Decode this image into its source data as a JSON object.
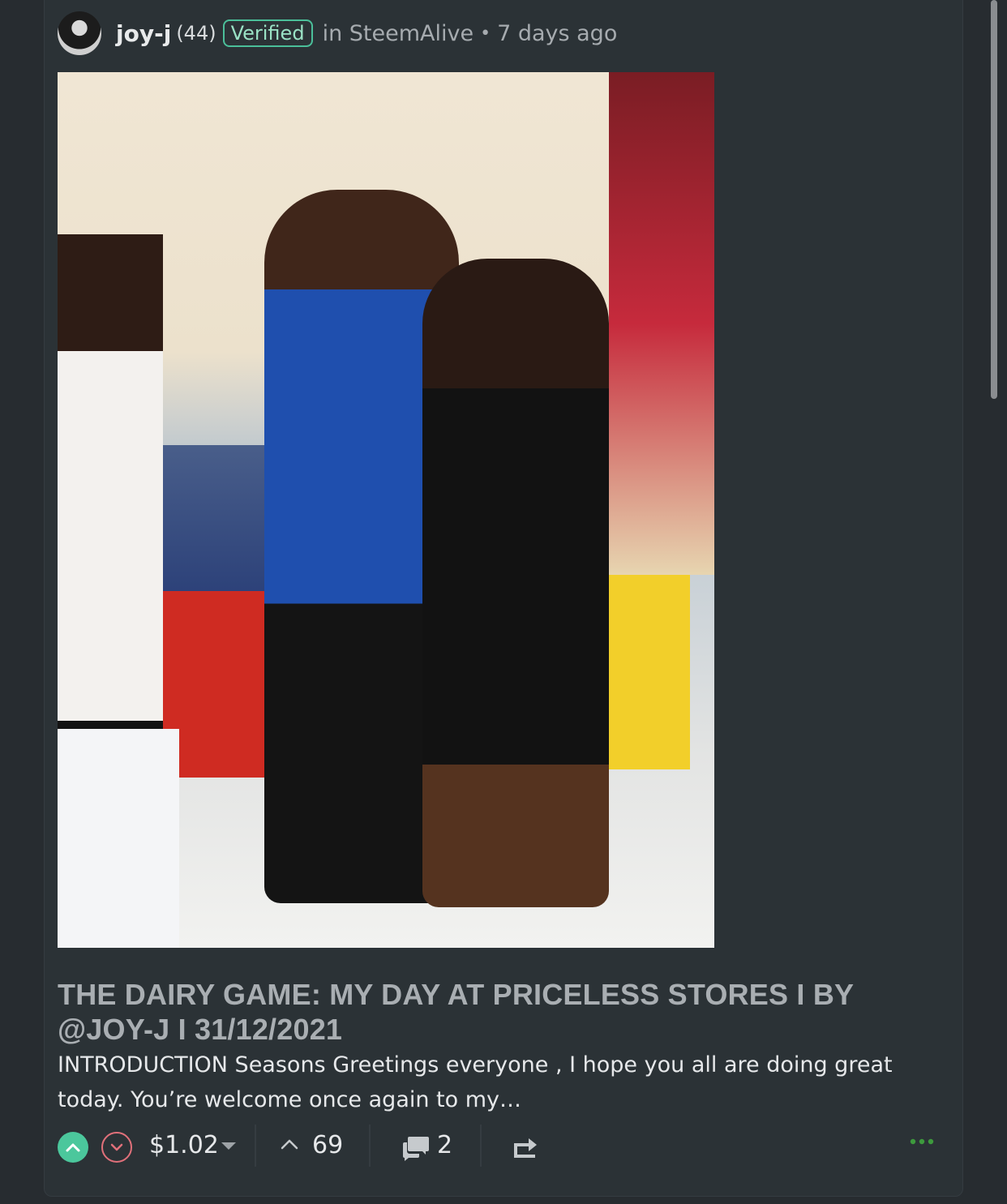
{
  "post": {
    "author": "joy-j",
    "reputation": "(44)",
    "badge": "Verified",
    "community": "in SteemAlive",
    "separator": "•",
    "time_ago": "7 days ago",
    "title": "THE DAIRY GAME: MY DAY AT PRICELESS STORES I BY @JOY-J I 31/12/2021",
    "excerpt": "INTRODUCTION Seasons Greetings everyone , I hope you all are doing great today. You’re welcome once again to my…"
  },
  "footer": {
    "payout": "$1.02",
    "votes": "69",
    "comments": "2"
  },
  "icons": {
    "upvote": "upvote-chevron-icon",
    "downvote": "downvote-chevron-icon",
    "payout_caret": "caret-down-icon",
    "votes": "chevron-up-icon",
    "comments": "speech-bubble-icon",
    "resteem": "reblog-arrow-icon",
    "more": "ellipsis-icon"
  },
  "colors": {
    "background": "#272c30",
    "card": "#2b3236",
    "accent": "#4bc79c",
    "downvote": "#e0707a",
    "badge_border": "#4bbf9a",
    "more_dots": "#3d9a3d"
  }
}
